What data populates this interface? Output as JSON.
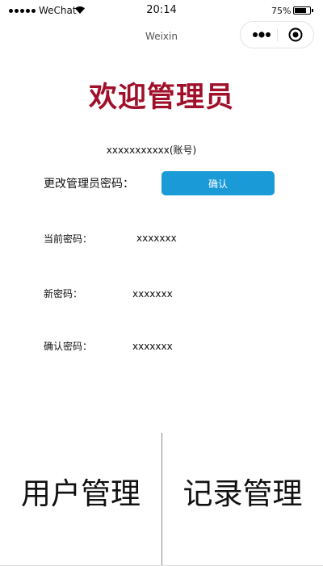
{
  "status_bar": {
    "carrier": "WeChat",
    "time": "20:14",
    "battery": "75%",
    "battery_level": 0.75
  },
  "nav": {
    "title": "Weixin",
    "menu_icon": "more-dots-icon",
    "close_icon": "target-circle-icon"
  },
  "welcome_title": "欢迎管理员",
  "account_text": "xxxxxxxxxxx(账号)",
  "change_password": {
    "label": "更改管理员密码：",
    "confirm_label": "确认"
  },
  "fields": {
    "current": {
      "label": "当前密码：",
      "value": "xxxxxxx"
    },
    "new": {
      "label": "新密码：",
      "value": "xxxxxxx"
    },
    "confirm": {
      "label": "确认密码：",
      "value": "xxxxxxx"
    }
  },
  "bottom_tabs": {
    "user_mgmt": "用户管理",
    "record_mgmt": "记录管理"
  },
  "colors": {
    "title": "#a0102a",
    "button": "#1a9ad6"
  }
}
